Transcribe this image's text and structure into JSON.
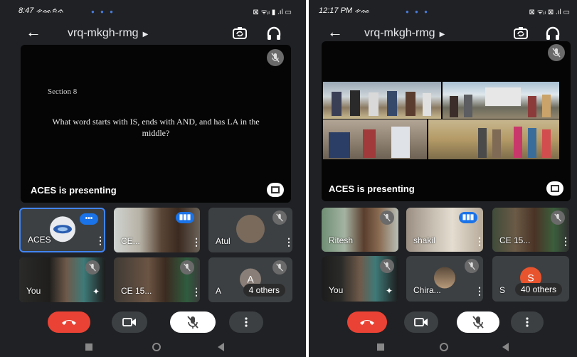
{
  "left": {
    "status": {
      "time": "8:47 ᨀᨐᨑᨊ",
      "signal": "⊠ ᯤᵢₗ ▮ .ıl ▭"
    },
    "meeting_code": "vrq-mkgh-rmg",
    "slide": {
      "heading": "Section 8",
      "question": "What word starts with IS, ends with AND, and has LA in the middle?"
    },
    "presenting_label": "ACES is presenting",
    "tiles": [
      {
        "name": "ACES"
      },
      {
        "name": "CE..."
      },
      {
        "name": "Atul"
      },
      {
        "name": "You"
      },
      {
        "name": "CE 15..."
      },
      {
        "name": "A",
        "avatar_letter": "A",
        "avatar_color": "#8a7f78",
        "others": "4 others"
      }
    ]
  },
  "right": {
    "status": {
      "time": "12:17 PM ᨀᨐ",
      "signal": "⊠ ᯤᵢₗ ⊠ .ıl ▭"
    },
    "meeting_code": "vrq-mkgh-rmg",
    "presenting_label": "ACES is presenting",
    "tiles": [
      {
        "name": "Ritesh"
      },
      {
        "name": "shakil"
      },
      {
        "name": "CE 15..."
      },
      {
        "name": "You"
      },
      {
        "name": "Chira..."
      },
      {
        "name": "S",
        "avatar_letter": "S",
        "avatar_color": "#e8542e",
        "others": "40 others"
      }
    ]
  },
  "colors": {
    "end_call": "#ea4335",
    "speaking": "#1a73e8",
    "tile_bg": "#3c4043",
    "app_bg": "#202124"
  },
  "icons": [
    "back-arrow-icon",
    "switch-camera-icon",
    "headphones-icon",
    "mic-off-icon",
    "fullscreen-icon",
    "end-call-icon",
    "camera-icon",
    "more-icon"
  ]
}
